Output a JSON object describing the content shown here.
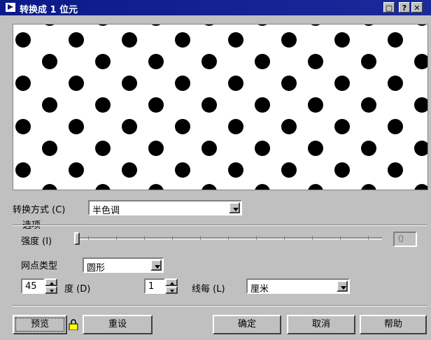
{
  "window": {
    "title": "转换成 1 位元",
    "icon": "app-arrow-icon",
    "buttons": {
      "maximize": "▢",
      "help": "?",
      "close": "✕"
    }
  },
  "conversion": {
    "label": "转换方式 (C)",
    "value": "半色调"
  },
  "options": {
    "group_label": "选项",
    "intensity": {
      "label": "强度 (I)",
      "value": "0"
    },
    "dot_type": {
      "label": "网点类型",
      "value": "圆形"
    },
    "angle": {
      "value": "45",
      "unit_label": "度 (D)"
    },
    "lines": {
      "value": "1",
      "label": "线每 (L)"
    },
    "unit": {
      "value": "厘米"
    }
  },
  "buttons": {
    "preview": "预览",
    "reset": "重设",
    "ok": "确定",
    "cancel": "取消",
    "help": "帮助"
  },
  "colors": {
    "titlebar": "#0a1a88",
    "face": "#c0c0c0"
  }
}
